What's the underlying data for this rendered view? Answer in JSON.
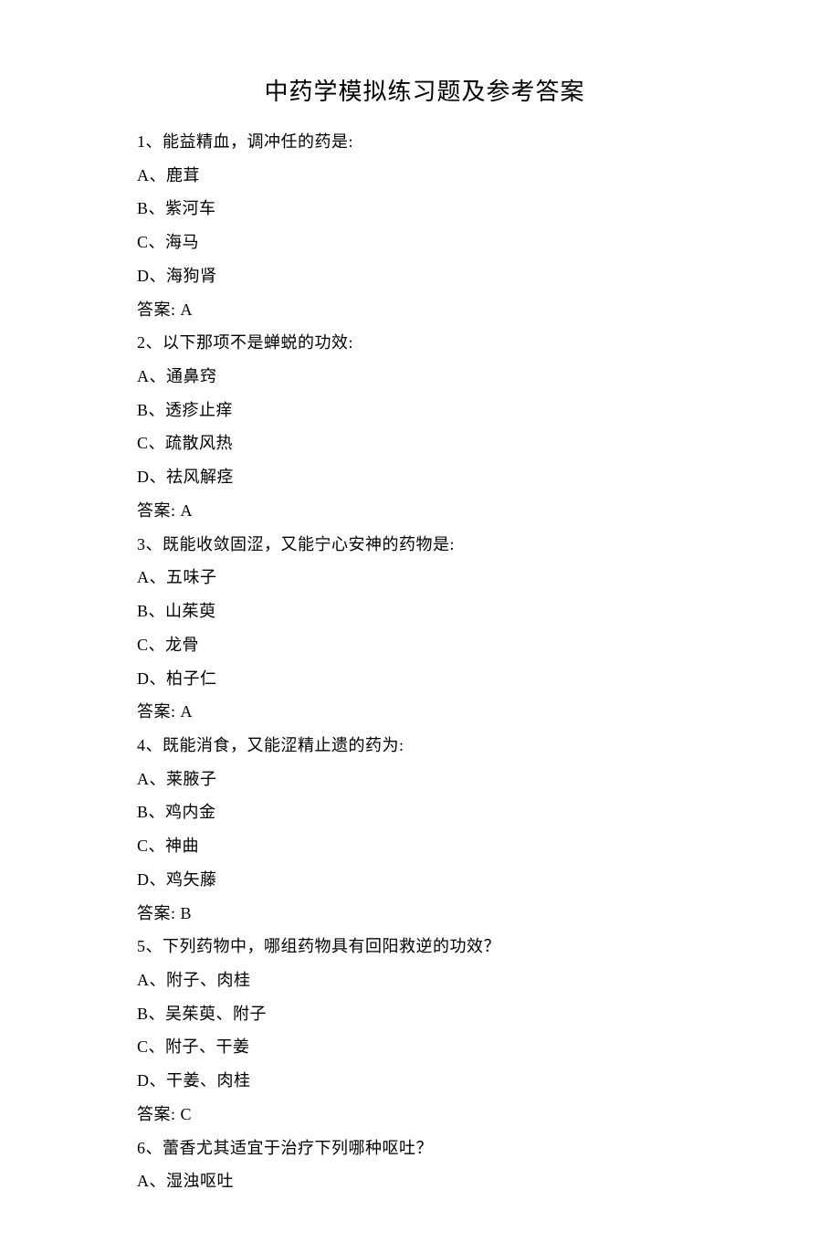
{
  "title": "中药学模拟练习题及参考答案",
  "questions": [
    {
      "num": "1",
      "text": "能益精血，调冲任的药是:",
      "options": [
        {
          "label": "A",
          "text": "鹿茸"
        },
        {
          "label": "B",
          "text": "紫河车"
        },
        {
          "label": "C",
          "text": "海马"
        },
        {
          "label": "D",
          "text": "海狗肾"
        }
      ],
      "answer_label": "答案:",
      "answer": "A"
    },
    {
      "num": "2",
      "text": "以下那项不是蝉蜕的功效:",
      "options": [
        {
          "label": "A",
          "text": "通鼻窍"
        },
        {
          "label": "B",
          "text": "透疹止痒"
        },
        {
          "label": "C",
          "text": "疏散风热"
        },
        {
          "label": "D",
          "text": "祛风解痉"
        }
      ],
      "answer_label": "答案:",
      "answer": "A"
    },
    {
      "num": "3",
      "text": "既能收敛固涩，又能宁心安神的药物是:",
      "options": [
        {
          "label": "A",
          "text": "五味子"
        },
        {
          "label": "B",
          "text": "山茱萸"
        },
        {
          "label": "C",
          "text": "龙骨"
        },
        {
          "label": "D",
          "text": "柏子仁"
        }
      ],
      "answer_label": "答案:",
      "answer": "A"
    },
    {
      "num": "4",
      "text": "既能消食，又能涩精止遗的药为:",
      "options": [
        {
          "label": "A",
          "text": "莱腋子"
        },
        {
          "label": "B",
          "text": "鸡内金"
        },
        {
          "label": "C",
          "text": "神曲"
        },
        {
          "label": "D",
          "text": "鸡矢藤"
        }
      ],
      "answer_label": "答案:",
      "answer": "B"
    },
    {
      "num": "5",
      "text": "下列药物中，哪组药物具有回阳救逆的功效？",
      "options": [
        {
          "label": "A",
          "text": "附子、肉桂"
        },
        {
          "label": "B",
          "text": "吴茱萸、附子"
        },
        {
          "label": "C",
          "text": "附子、干姜"
        },
        {
          "label": "D",
          "text": "干姜、肉桂"
        }
      ],
      "answer_label": "答案:",
      "answer": "C"
    },
    {
      "num": "6",
      "text": "蕾香尤其适宜于治疗下列哪种呕吐？",
      "options": [
        {
          "label": "A",
          "text": "湿浊呕吐"
        }
      ],
      "answer_label": "",
      "answer": ""
    }
  ]
}
